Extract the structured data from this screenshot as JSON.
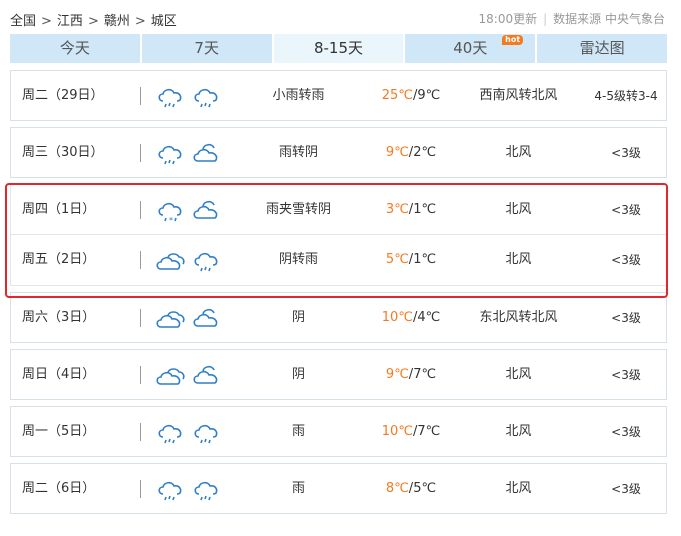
{
  "breadcrumb": {
    "items": [
      "全国",
      "江西",
      "赣州",
      "城区"
    ],
    "separator": ">"
  },
  "update": {
    "time": "18:00更新",
    "source": "数据来源 中央气象台"
  },
  "tabs": [
    {
      "label": "今天",
      "active": false
    },
    {
      "label": "7天",
      "active": false
    },
    {
      "label": "8-15天",
      "active": true
    },
    {
      "label": "40天",
      "active": false,
      "badge": "hot"
    },
    {
      "label": "雷达图",
      "active": false
    }
  ],
  "colors": {
    "high_temp": "#f57a1f",
    "tab_bg": "#cfe7f7",
    "highlight_border": "#e3252d",
    "icon_stroke": "#2f7fc7"
  },
  "forecast": [
    {
      "day": "周二（29日）",
      "icons": [
        "cloud-rain-icon",
        "cloud-rain-icon"
      ],
      "desc": "小雨转雨",
      "high": "25℃",
      "low": "9℃",
      "wind": "西南风转北风",
      "level": "4-5级转3-4"
    },
    {
      "day": "周三（30日）",
      "icons": [
        "cloud-rain-icon",
        "partly-cloudy-icon"
      ],
      "desc": "雨转阴",
      "high": "9℃",
      "low": "2℃",
      "wind": "北风",
      "level": "<3级"
    },
    {
      "day": "周四（1日）",
      "icons": [
        "sleet-icon",
        "partly-cloudy-icon"
      ],
      "desc": "雨夹雪转阴",
      "high": "3℃",
      "low": "1℃",
      "wind": "北风",
      "level": "<3级"
    },
    {
      "day": "周五（2日）",
      "icons": [
        "overcast-icon",
        "cloud-rain-icon"
      ],
      "desc": "阴转雨",
      "high": "5℃",
      "low": "1℃",
      "wind": "北风",
      "level": "<3级"
    },
    {
      "day": "周六（3日）",
      "icons": [
        "overcast-icon",
        "partly-cloudy-icon"
      ],
      "desc": "阴",
      "high": "10℃",
      "low": "4℃",
      "wind": "东北风转北风",
      "level": "<3级"
    },
    {
      "day": "周日（4日）",
      "icons": [
        "overcast-icon",
        "partly-cloudy-icon"
      ],
      "desc": "阴",
      "high": "9℃",
      "low": "7℃",
      "wind": "北风",
      "level": "<3级"
    },
    {
      "day": "周一（5日）",
      "icons": [
        "cloud-rain-icon",
        "cloud-rain-icon"
      ],
      "desc": "雨",
      "high": "10℃",
      "low": "7℃",
      "wind": "北风",
      "level": "<3级"
    },
    {
      "day": "周二（6日）",
      "icons": [
        "cloud-rain-icon",
        "cloud-rain-icon"
      ],
      "desc": "雨",
      "high": "8℃",
      "low": "5℃",
      "wind": "北风",
      "level": "<3级"
    }
  ]
}
